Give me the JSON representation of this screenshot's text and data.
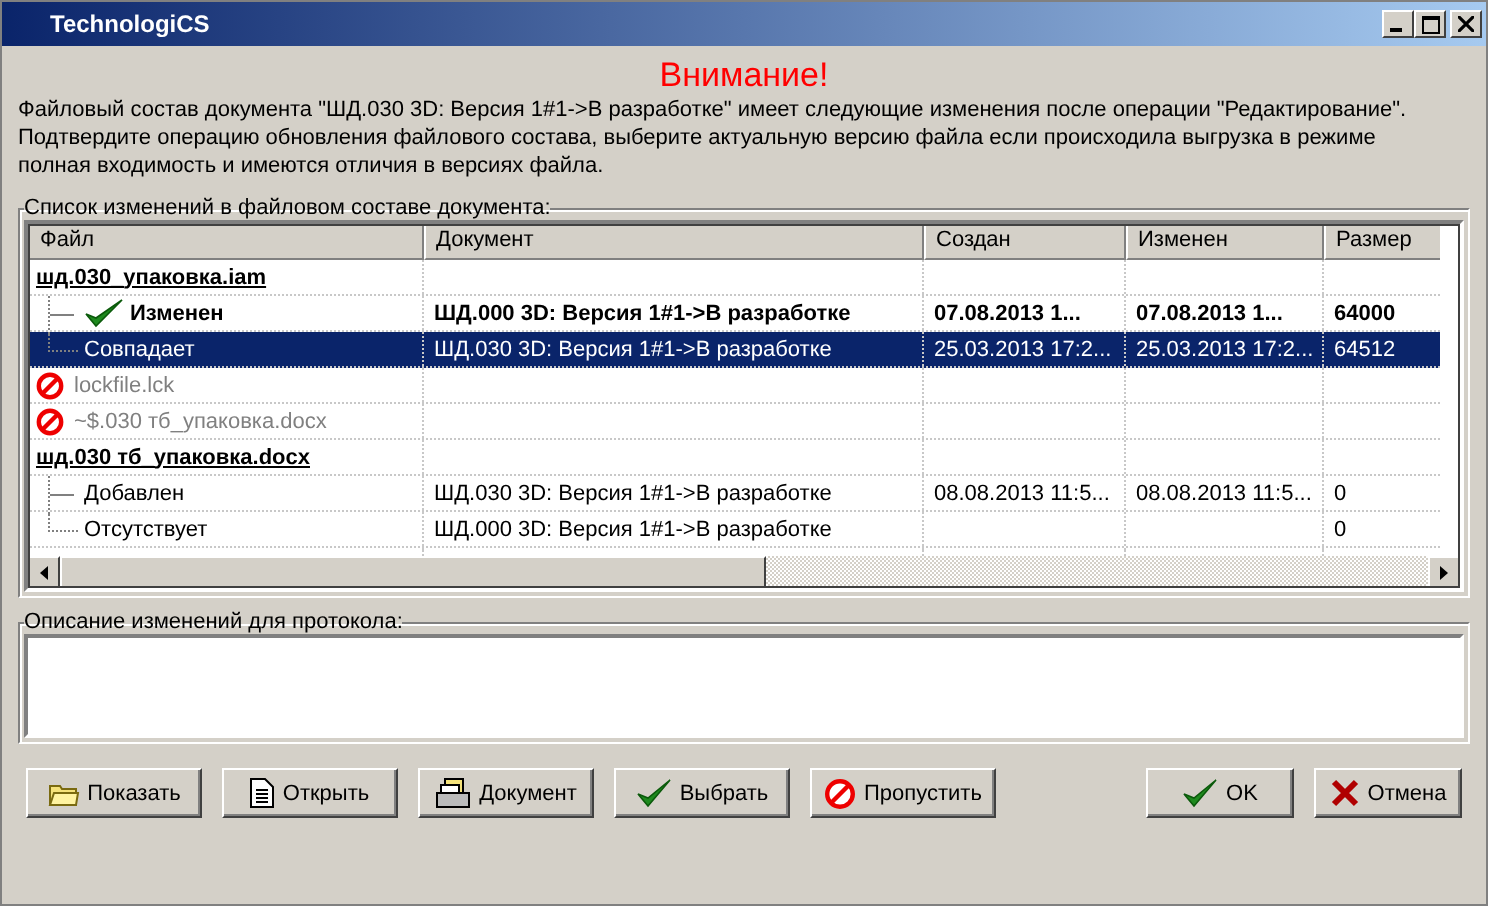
{
  "window": {
    "title": "TechnologiCS"
  },
  "heading": "Внимание!",
  "message": "Файловый состав документа \"ШД.030 3D: Версия 1#1->В разработке\" имеет следующие изменения после операции \"Редактирование\". Подтвердите операцию обновления файлового состава, выберите актуальную версию файла если происходила выгрузка в режиме полная входимость и имеются отличия в версиях файла.",
  "changes": {
    "label": "Список изменений в файловом составе документа:",
    "columns": [
      "Файл",
      "Документ",
      "Создан",
      "Изменен",
      "Размер"
    ],
    "rows": [
      {
        "kind": "group",
        "file": "шд.030_упаковка.iam",
        "selected": false
      },
      {
        "kind": "item",
        "file": "Изменен",
        "document": "ШД.000 3D: Версия 1#1->В разработке",
        "created": "07.08.2013 1...",
        "modified": "07.08.2013 1...",
        "size": "64000",
        "chosen": true,
        "selected": false
      },
      {
        "kind": "item",
        "file": "Совпадает",
        "document": "ШД.030 3D: Версия 1#1->В разработке",
        "created": "25.03.2013 17:2...",
        "modified": "25.03.2013 17:2...",
        "size": "64512",
        "chosen": false,
        "selected": true
      },
      {
        "kind": "skipped",
        "file": "lockfile.lck",
        "selected": false
      },
      {
        "kind": "skipped",
        "file": "~$.030 тб_упаковка.docx",
        "selected": false
      },
      {
        "kind": "group",
        "file": "шд.030 тб_упаковка.docx",
        "selected": false
      },
      {
        "kind": "item",
        "file": "Добавлен",
        "document": "ШД.030 3D: Версия 1#1->В разработке",
        "created": "08.08.2013 11:5...",
        "modified": "08.08.2013 11:5...",
        "size": "0",
        "chosen": false,
        "selected": false
      },
      {
        "kind": "item",
        "file": "Отсутствует",
        "document": "ШД.000 3D: Версия 1#1->В разработке",
        "size": "0",
        "chosen": false,
        "selected": false
      }
    ]
  },
  "description": {
    "label": "Описание изменений для протокола:"
  },
  "buttons": [
    {
      "kind": "folder",
      "label": "Показать"
    },
    {
      "kind": "page",
      "label": "Открыть"
    },
    {
      "kind": "stack",
      "label": "Документ"
    },
    {
      "kind": "check",
      "label": "Выбрать"
    },
    {
      "kind": "stop",
      "label": "Пропустить"
    }
  ],
  "dialog_buttons": [
    {
      "kind": "check",
      "label": "OK"
    },
    {
      "kind": "cross",
      "label": "Отмена"
    }
  ]
}
